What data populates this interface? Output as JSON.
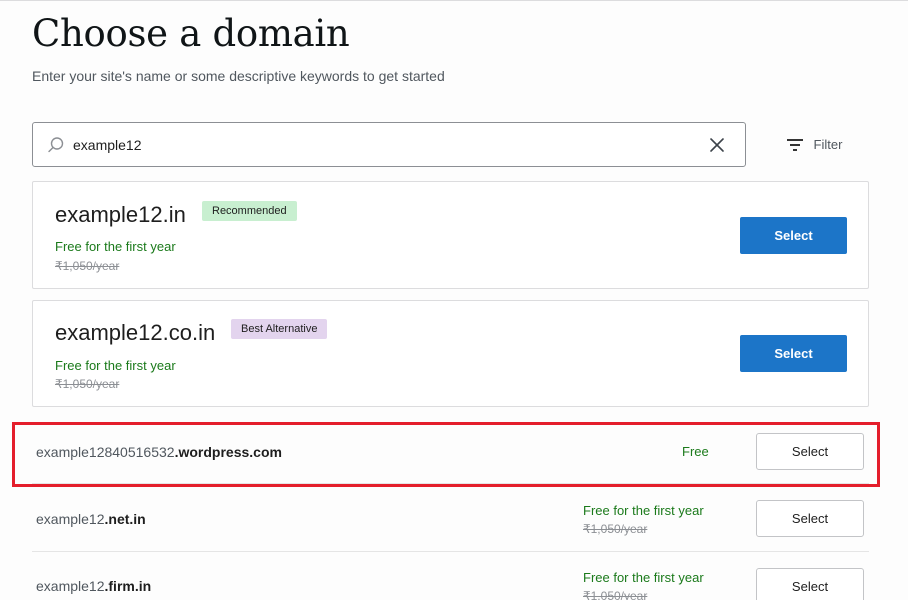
{
  "header": {
    "title": "Choose a domain",
    "subtitle": "Enter your site's name or some descriptive keywords to get started"
  },
  "search": {
    "value": "example12",
    "icon": "search-icon",
    "clear_icon": "close-icon"
  },
  "filter": {
    "label": "Filter",
    "icon": "filter-icon"
  },
  "featured": [
    {
      "domain": "example12.in",
      "badge": "Recommended",
      "badge_color": "#c8efd0",
      "promo": "Free for the first year",
      "old_price": "₹1,050/year",
      "button": "Select"
    },
    {
      "domain": "example12.co.in",
      "badge": "Best Alternative",
      "badge_color": "#e3d4ee",
      "promo": "Free for the first year",
      "old_price": "₹1,050/year",
      "button": "Select"
    }
  ],
  "results": [
    {
      "domain_prefix": "example12840516532",
      "domain_suffix": ".wordpress.com",
      "price": "Free",
      "button": "Select"
    },
    {
      "domain_prefix": "example12",
      "domain_suffix": ".net.in",
      "promo": "Free for the first year",
      "old_price": "₹1,050/year",
      "button": "Select"
    },
    {
      "domain_prefix": "example12",
      "domain_suffix": ".firm.in",
      "promo": "Free for the first year",
      "old_price": "₹1,050/year",
      "button": "Select"
    }
  ],
  "colors": {
    "primary": "#1c75c8",
    "promo_green": "#1b7a1b",
    "highlight": "#e41e2b"
  }
}
